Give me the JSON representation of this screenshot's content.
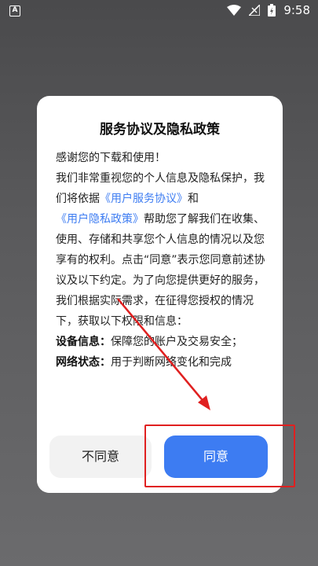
{
  "status_bar": {
    "left_icon": "A",
    "time": "9:58",
    "icons": [
      "wifi-icon",
      "signal-icon",
      "battery-icon"
    ]
  },
  "dialog": {
    "title": "服务协议及隐私政策",
    "paragraphs": {
      "p1": "感谢您的下载和使用！",
      "p2a": "我们非常重视您的个人信息及隐私保护，我们将依据",
      "link1": "《用户服务协议》",
      "p2b": "和",
      "link2": "《用户隐私政策》",
      "p2c": "帮助您了解我们在收集、使用、存储和共享您个人信息的情况以及您享有的权利。点击“同意”表示您同意前述协议及以下约定。为了向您提供更好的服务，我们根据实际需求，在征得您授权的情况下，获取以下权限和信息：",
      "item1_label": "设备信息：",
      "item1_text": "保障您的账户及交易安全；",
      "item2_label": "网络状态：",
      "item2_text": "用于判断网络变化和完成"
    },
    "buttons": {
      "disagree": "不同意",
      "agree": "同意"
    }
  },
  "colors": {
    "accent": "#3d7cf2",
    "annotation": "#e02020",
    "backdrop": "#5a5a5c"
  }
}
